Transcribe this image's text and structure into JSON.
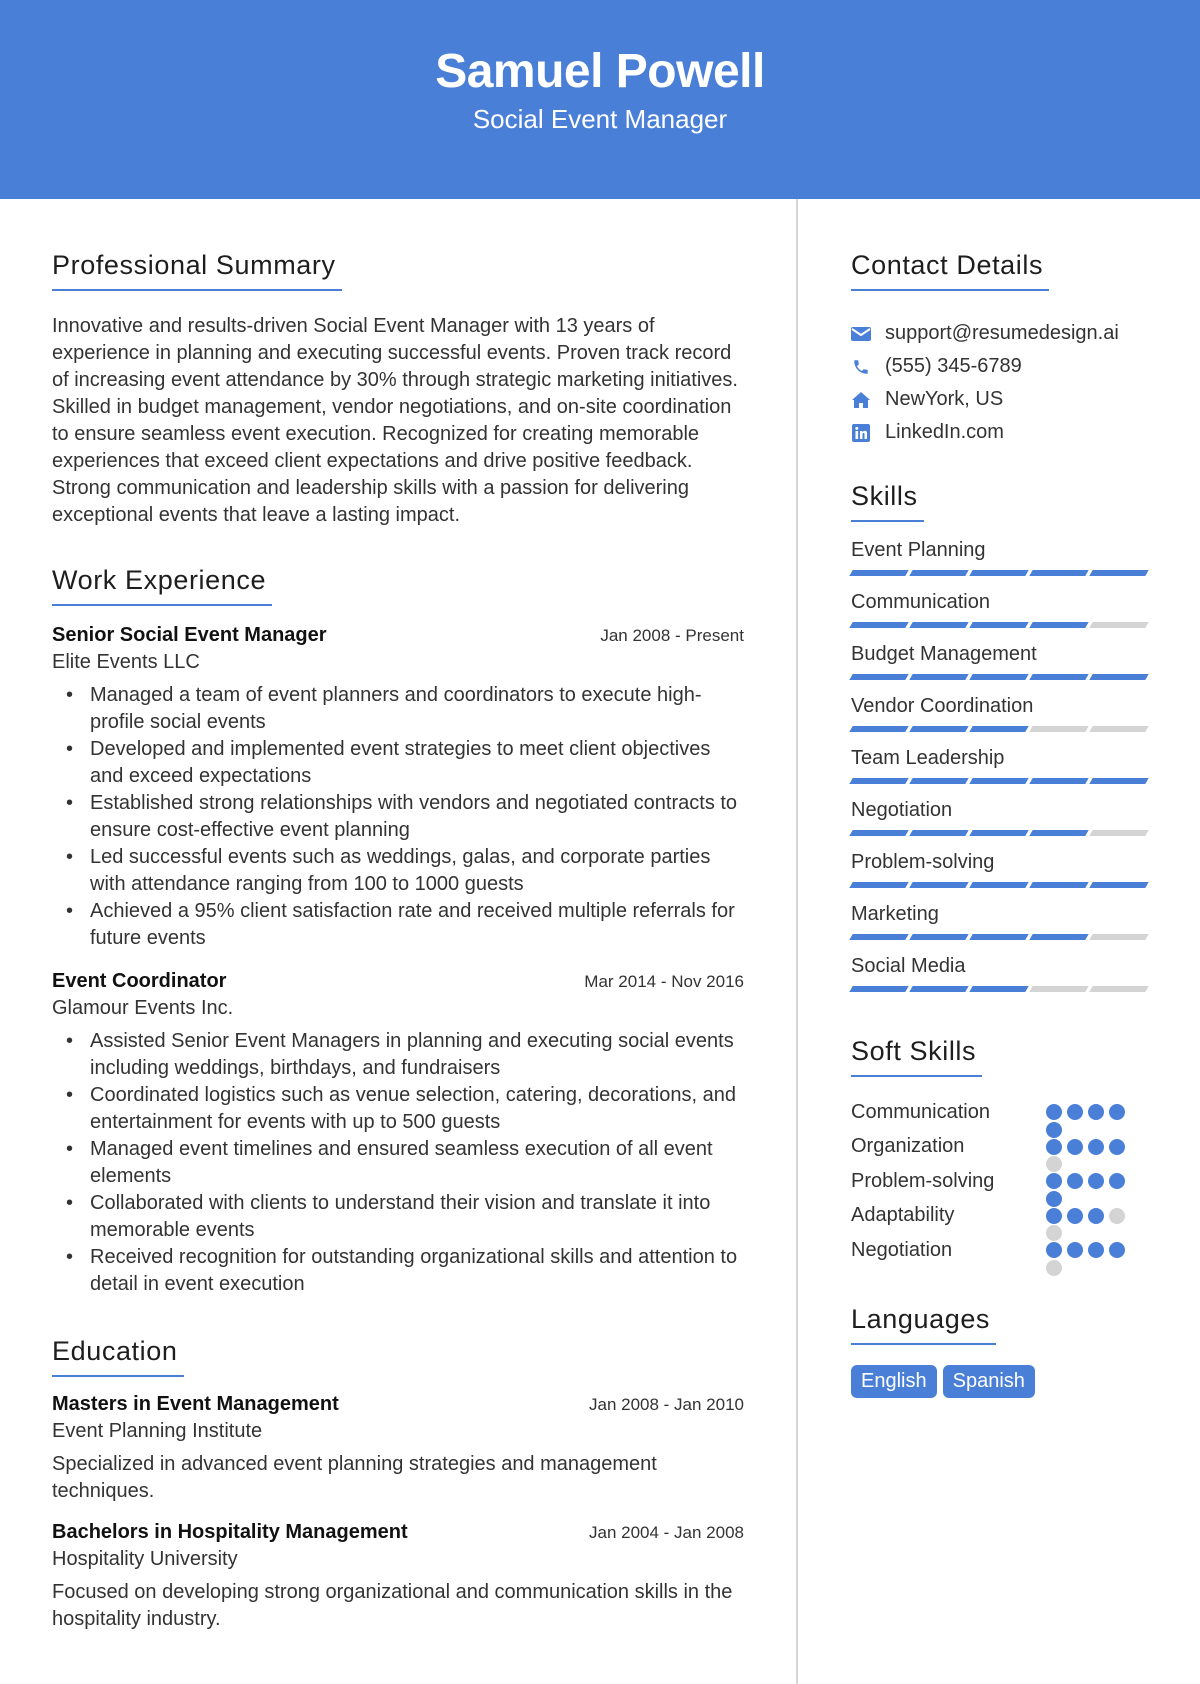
{
  "header": {
    "name": "Samuel Powell",
    "role": "Social Event Manager"
  },
  "colors": {
    "accent": "#4a7fd8",
    "inactive": "#d4d4d4"
  },
  "summary": {
    "title": "Professional Summary",
    "text": "Innovative and results-driven Social Event Manager with 13 years of experience in planning and executing successful events. Proven track record of increasing event attendance by 30% through strategic marketing initiatives. Skilled in budget management, vendor negotiations, and on-site coordination to ensure seamless event execution. Recognized for creating memorable experiences that exceed client expectations and drive positive feedback. Strong communication and leadership skills with a passion for delivering exceptional events that leave a lasting impact."
  },
  "experience": {
    "title": "Work Experience",
    "jobs": [
      {
        "title": "Senior Social Event Manager",
        "date": "Jan 2008 - Present",
        "company": "Elite Events LLC",
        "bullets": [
          "Managed a team of event planners and coordinators to execute high-profile social events",
          "Developed and implemented event strategies to meet client objectives and exceed expectations",
          "Established strong relationships with vendors and negotiated contracts to ensure cost-effective event planning",
          "Led successful events such as weddings, galas, and corporate parties with attendance ranging from 100 to 1000 guests",
          "Achieved a 95% client satisfaction rate and received multiple referrals for future events"
        ]
      },
      {
        "title": "Event Coordinator",
        "date": "Mar 2014 - Nov 2016",
        "company": "Glamour Events Inc.",
        "bullets": [
          "Assisted Senior Event Managers in planning and executing social events including weddings, birthdays, and fundraisers",
          "Coordinated logistics such as venue selection, catering, decorations, and entertainment for events with up to 500 guests",
          "Managed event timelines and ensured seamless execution of all event elements",
          "Collaborated with clients to understand their vision and translate it into memorable events",
          "Received recognition for outstanding organizational skills and attention to detail in event execution"
        ]
      }
    ]
  },
  "education": {
    "title": "Education",
    "items": [
      {
        "degree": "Masters in Event Management",
        "date": "Jan 2008 - Jan 2010",
        "school": "Event Planning Institute",
        "description": "Specialized in advanced event planning strategies and management techniques."
      },
      {
        "degree": "Bachelors in Hospitality Management",
        "date": "Jan 2004 - Jan 2008",
        "school": "Hospitality University",
        "description": "Focused on developing strong organizational and communication skills in the hospitality industry."
      }
    ]
  },
  "contact": {
    "title": "Contact Details",
    "items": [
      {
        "icon": "envelope-icon",
        "text": "support@resumedesign.ai"
      },
      {
        "icon": "phone-icon",
        "text": "(555) 345-6789"
      },
      {
        "icon": "home-icon",
        "text": "NewYork, US"
      },
      {
        "icon": "linkedin-icon",
        "text": "LinkedIn.com"
      }
    ]
  },
  "skills": {
    "title": "Skills",
    "max": 5,
    "items": [
      {
        "name": "Event Planning",
        "level": 5
      },
      {
        "name": "Communication",
        "level": 4
      },
      {
        "name": "Budget Management",
        "level": 5
      },
      {
        "name": "Vendor Coordination",
        "level": 3
      },
      {
        "name": "Team Leadership",
        "level": 5
      },
      {
        "name": "Negotiation",
        "level": 4
      },
      {
        "name": "Problem-solving",
        "level": 5
      },
      {
        "name": "Marketing",
        "level": 4
      },
      {
        "name": "Social Media",
        "level": 3
      }
    ]
  },
  "soft_skills": {
    "title": "Soft Skills",
    "max": 5,
    "items": [
      {
        "name": "Communication",
        "level": 5
      },
      {
        "name": "Organization",
        "level": 4
      },
      {
        "name": "Problem-solving",
        "level": 5
      },
      {
        "name": "Adaptability",
        "level": 3
      },
      {
        "name": "Negotiation",
        "level": 4
      }
    ]
  },
  "languages": {
    "title": "Languages",
    "items": [
      "English",
      "Spanish"
    ]
  }
}
